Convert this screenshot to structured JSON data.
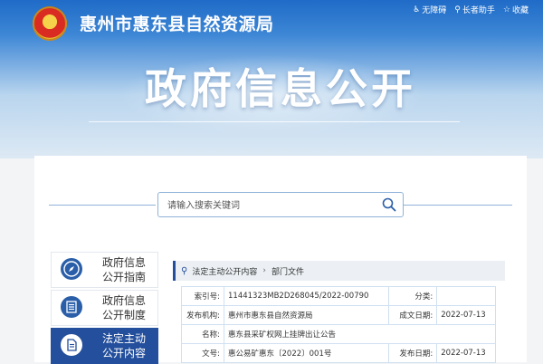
{
  "header": {
    "org_name": "惠州市惠东县自然资源局",
    "main_title": "政府信息公开",
    "top_links": [
      {
        "label": "无障碍",
        "icon": "accessibility-icon"
      },
      {
        "label": "长者助手",
        "icon": "elder-assist-icon"
      },
      {
        "label": "收藏",
        "icon": "star-icon"
      }
    ]
  },
  "search": {
    "placeholder": "请输入搜索关键词"
  },
  "sidebar": {
    "items": [
      {
        "label": "政府信息公开指南",
        "icon": "compass-icon",
        "active": false
      },
      {
        "label": "政府信息公开制度",
        "icon": "list-icon",
        "active": false
      },
      {
        "label": "法定主动公开内容",
        "icon": "document-icon",
        "active": true
      }
    ]
  },
  "breadcrumb": {
    "items": [
      "法定主动公开内容",
      "部门文件"
    ]
  },
  "info": {
    "index_label": "索引号:",
    "index_value": "11441323MB2D268045/2022-00790",
    "category_label": "分类:",
    "category_value": "",
    "publisher_label": "发布机构:",
    "publisher_value": "惠州市惠东县自然资源局",
    "created_label": "成文日期:",
    "created_value": "2022-07-13",
    "name_label": "名称:",
    "name_value": "惠东县采矿权网上挂牌出让公告",
    "doc_no_label": "文号:",
    "doc_no_value": "惠公易矿惠东〔2022〕001号",
    "published_label": "发布日期:",
    "published_value": "2022-07-13"
  },
  "colors": {
    "primary": "#244f9c",
    "header_blue": "#1f6bc7",
    "border": "#cfe0f1"
  }
}
